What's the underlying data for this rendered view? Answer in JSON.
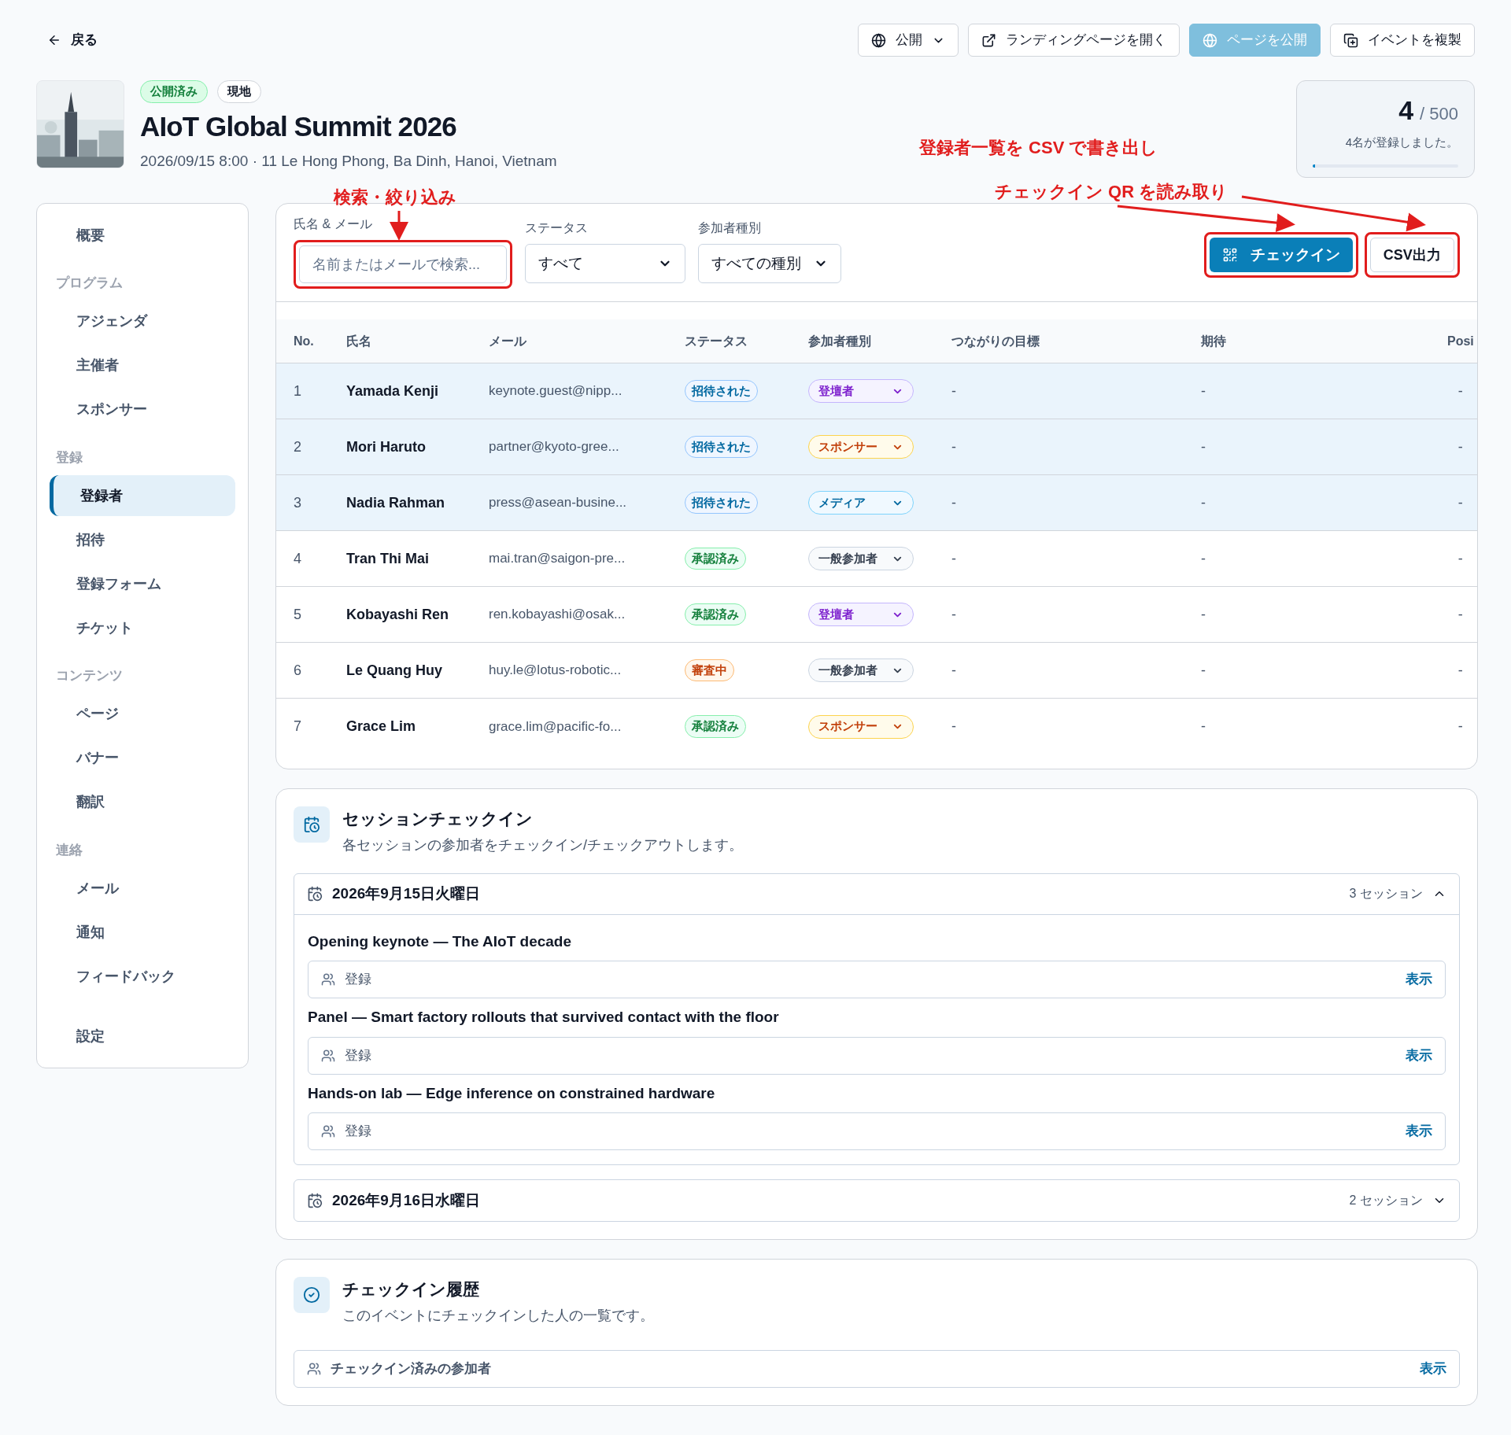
{
  "back": {
    "label": "戻る"
  },
  "header_actions": [
    {
      "kind": "visibility",
      "label": "公開",
      "disabled": false
    },
    {
      "kind": "open_landing",
      "label": "ランディングページを開く",
      "disabled": false
    },
    {
      "kind": "publish",
      "label": "ページを公開",
      "disabled": true
    },
    {
      "kind": "duplicate",
      "label": "イベントを複製",
      "disabled": false
    }
  ],
  "event": {
    "badges": [
      {
        "label": "公開済み",
        "kind": "published"
      },
      {
        "label": "現地",
        "kind": "neutral"
      }
    ],
    "title": "AIoT Global Summit 2026",
    "meta": "2026/09/15 8:00 · 11 Le Hong Phong, Ba Dinh, Hanoi, Vietnam"
  },
  "capacity": {
    "count": "4",
    "total": "/ 500",
    "caption": "4名が登録しました。",
    "level": 0.008
  },
  "annotations": [
    {
      "text": "検索・絞り込み"
    },
    {
      "text": "登録者一覧を CSV で書き出し"
    },
    {
      "text": "チェックイン QR を読み取り"
    }
  ],
  "sidebar": {
    "sections": [
      {
        "items": [
          {
            "label": "概要",
            "selected": false
          }
        ]
      },
      {
        "heading": "プログラム",
        "items": [
          {
            "label": "アジェンダ",
            "selected": false
          },
          {
            "label": "主催者",
            "selected": false
          },
          {
            "label": "スポンサー",
            "selected": false
          }
        ]
      },
      {
        "heading": "登録",
        "items": [
          {
            "label": "登録者",
            "selected": true
          },
          {
            "label": "招待",
            "selected": false
          },
          {
            "label": "登録フォーム",
            "selected": false
          },
          {
            "label": "チケット",
            "selected": false
          }
        ]
      },
      {
        "heading": "コンテンツ",
        "items": [
          {
            "label": "ページ",
            "selected": false
          },
          {
            "label": "バナー",
            "selected": false
          },
          {
            "label": "翻訳",
            "selected": false
          }
        ]
      },
      {
        "heading": "連絡",
        "items": [
          {
            "label": "メール",
            "selected": false
          },
          {
            "label": "通知",
            "selected": false
          },
          {
            "label": "フィードバック",
            "selected": false
          }
        ]
      },
      {
        "items": [
          {
            "label": "設定",
            "selected": false
          }
        ]
      }
    ]
  },
  "filters": {
    "search": {
      "label": "氏名 & メール",
      "placeholder": "名前またはメールで検索..."
    },
    "status": {
      "label": "ステータス",
      "value": "すべて"
    },
    "type": {
      "label": "参加者種別",
      "value": "すべての種別"
    },
    "checkin_button": "チェックイン",
    "csv_button": "CSV出力"
  },
  "table": {
    "columns": [
      "No.",
      "氏名",
      "メール",
      "ステータス",
      "参加者種別",
      "つながりの目標",
      "期待",
      "Posi"
    ],
    "rows": [
      {
        "no": "1",
        "name": "Yamada Kenji",
        "email": "keynote.guest@nipp...",
        "status": {
          "label": "招待された",
          "kind": "invited"
        },
        "type": {
          "label": "登壇者",
          "kind": "speaker"
        },
        "goal": "-",
        "expectation": "-",
        "col_8": "-",
        "highlighted": true
      },
      {
        "no": "2",
        "name": "Mori Haruto",
        "email": "partner@kyoto-gree...",
        "status": {
          "label": "招待された",
          "kind": "invited"
        },
        "type": {
          "label": "スポンサー",
          "kind": "sponsor"
        },
        "goal": "-",
        "expectation": "-",
        "col_8": "-",
        "highlighted": true
      },
      {
        "no": "3",
        "name": "Nadia Rahman",
        "email": "press@asean-busine...",
        "status": {
          "label": "招待された",
          "kind": "invited"
        },
        "type": {
          "label": "メディア",
          "kind": "media"
        },
        "goal": "-",
        "expectation": "-",
        "col_8": "-",
        "highlighted": true
      },
      {
        "no": "4",
        "name": "Tran Thi Mai",
        "email": "mai.tran@saigon-pre...",
        "status": {
          "label": "承認済み",
          "kind": "approved"
        },
        "type": {
          "label": "一般参加者",
          "kind": "general"
        },
        "goal": "-",
        "expectation": "-",
        "col_8": "-",
        "highlighted": false
      },
      {
        "no": "5",
        "name": "Kobayashi Ren",
        "email": "ren.kobayashi@osak...",
        "status": {
          "label": "承認済み",
          "kind": "approved"
        },
        "type": {
          "label": "登壇者",
          "kind": "speaker"
        },
        "goal": "-",
        "expectation": "-",
        "col_8": "-",
        "highlighted": false
      },
      {
        "no": "6",
        "name": "Le Quang Huy",
        "email": "huy.le@lotus-robotic...",
        "status": {
          "label": "審査中",
          "kind": "review"
        },
        "type": {
          "label": "一般参加者",
          "kind": "general"
        },
        "goal": "-",
        "expectation": "-",
        "col_8": "-",
        "highlighted": false
      },
      {
        "no": "7",
        "name": "Grace Lim",
        "email": "grace.lim@pacific-fo...",
        "status": {
          "label": "承認済み",
          "kind": "approved"
        },
        "type": {
          "label": "スポンサー",
          "kind": "sponsor"
        },
        "goal": "-",
        "expectation": "-",
        "col_8": "-",
        "highlighted": false
      }
    ]
  },
  "session_checkin": {
    "title": "セッションチェックイン",
    "subtitle": "各セッションの参加者をチェックイン/チェックアウトします。",
    "days": [
      {
        "date": "2026年9月15日火曜日",
        "count": "3 セッション",
        "expanded": true,
        "sessions": [
          {
            "title": "Opening keynote — The AIoT decade",
            "label": "登録",
            "action": "表示"
          },
          {
            "title": "Panel — Smart factory rollouts that survived contact with the floor",
            "label": "登録",
            "action": "表示"
          },
          {
            "title": "Hands-on lab — Edge inference on constrained hardware",
            "label": "登録",
            "action": "表示"
          }
        ]
      },
      {
        "date": "2026年9月16日水曜日",
        "count": "2 セッション",
        "expanded": false
      }
    ]
  },
  "checkin_history": {
    "title": "チェックイン履歴",
    "subtitle": "このイベントにチェックインした人の一覧です。",
    "row_label": "チェックイン済みの参加者",
    "action": "表示"
  }
}
